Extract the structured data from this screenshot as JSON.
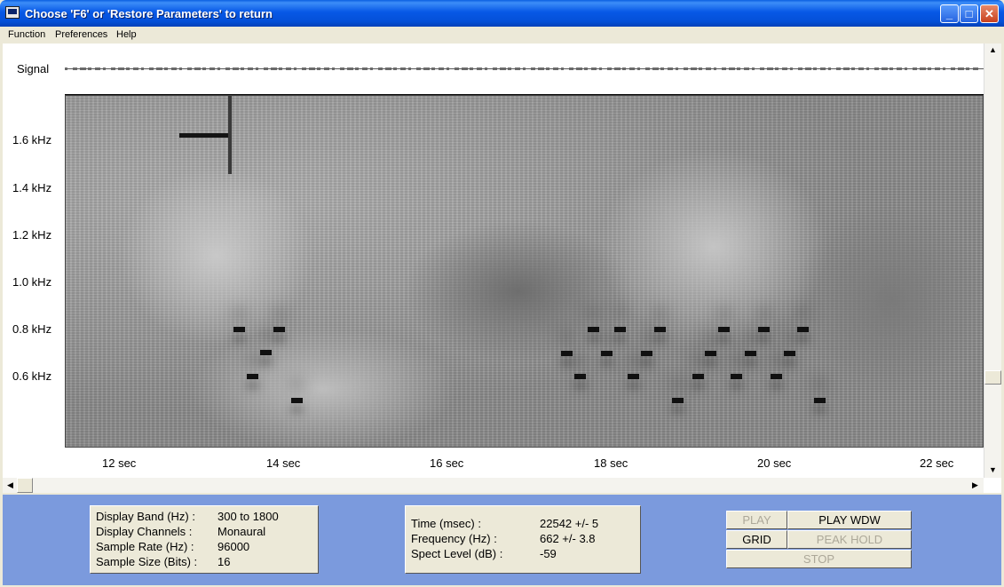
{
  "window": {
    "title": "Choose 'F6' or 'Restore Parameters' to return",
    "minimize": "_",
    "maximize": "□",
    "close": "✕"
  },
  "menu": [
    "Function",
    "Preferences",
    "Help"
  ],
  "signal_label": "Signal",
  "y_axis": [
    "1.6 kHz",
    "1.4 kHz",
    "1.2 kHz",
    "1.0 kHz",
    "0.8 kHz",
    "0.6 kHz"
  ],
  "x_axis": [
    "12  sec",
    "14  sec",
    "16  sec",
    "18  sec",
    "20  sec",
    "22  sec"
  ],
  "settings": {
    "display_band_label": "Display Band (Hz) :",
    "display_band_value": "300 to 1800",
    "display_channels_label": "Display Channels :",
    "display_channels_value": "Monaural",
    "sample_rate_label": "Sample Rate (Hz) :",
    "sample_rate_value": "96000",
    "sample_size_label": "Sample Size (Bits) :",
    "sample_size_value": "16"
  },
  "readout": {
    "time_label": "Time (msec) :",
    "time_value": "22542 +/- 5",
    "frequency_label": "Frequency (Hz) :",
    "frequency_value": "662  +/- 3.8",
    "spect_level_label": "Spect Level (dB) :",
    "spect_level_value": "-59"
  },
  "buttons": {
    "play": "PLAY",
    "play_wdw": "PLAY WDW",
    "grid": "GRID",
    "peak_hold": "PEAK HOLD",
    "stop": "STOP"
  },
  "colors": {
    "titlebar": "#0758e6",
    "panel_bg": "#7b9add",
    "face": "#ece9d8",
    "disabled_text": "#aca899"
  }
}
